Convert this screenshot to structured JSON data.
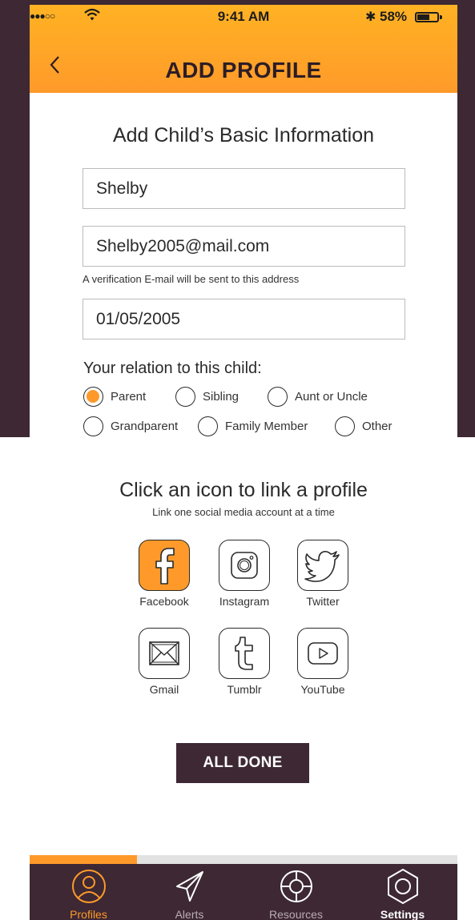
{
  "status_bar": {
    "time": "9:41 AM",
    "battery": "58%"
  },
  "header": {
    "title": "ADD PROFILE"
  },
  "form": {
    "section_title": "Add Child’s Basic Information",
    "name": "Shelby",
    "email": "Shelby2005@mail.com",
    "email_hint": "A verification E-mail will be sent to this address",
    "dob": "01/05/2005",
    "relation_question": "Your relation to this child:",
    "relations": [
      "Parent",
      "Sibling",
      "Aunt or Uncle",
      "Grandparent",
      "Family Member",
      "Other"
    ],
    "selected_relation": "Parent"
  },
  "social": {
    "title": "Click an icon to link a profile",
    "subtitle": "Link one social media account at a time",
    "items": [
      "Facebook",
      "Instagram",
      "Twitter",
      "Gmail",
      "Tumblr",
      "YouTube"
    ],
    "active": "Facebook"
  },
  "done_label": "ALL DONE",
  "progress_fraction": 0.25,
  "tabs": [
    {
      "label": "Profiles",
      "icon": "profile-icon"
    },
    {
      "label": "Alerts",
      "icon": "paper-plane-icon"
    },
    {
      "label": "Resources",
      "icon": "lifebuoy-icon"
    },
    {
      "label": "Settings",
      "icon": "hex-nut-icon"
    }
  ],
  "colors": {
    "accent": "#ff9a2a",
    "header_top": "#ffb223",
    "dark": "#3d2834"
  }
}
